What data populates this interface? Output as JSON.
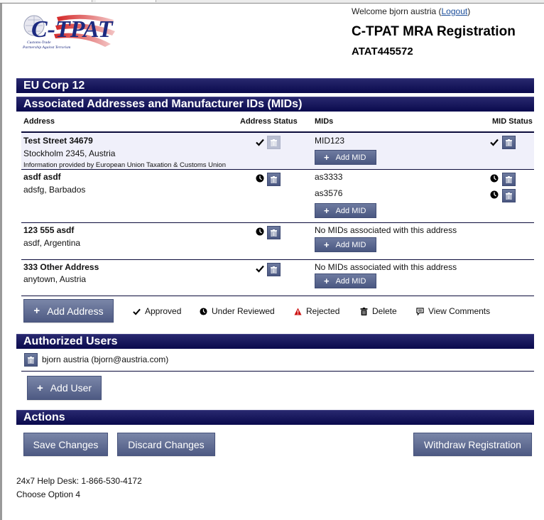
{
  "header": {
    "welcome_prefix": "Welcome bjorn austria (",
    "logout_label": "Logout",
    "welcome_suffix": ")",
    "title": "C-TPAT MRA Registration",
    "registration_id": "ATAT445572",
    "logo": {
      "main": "C-TPAT",
      "tagline_1": "Customs-Trade",
      "tagline_2": "Partnership Against Terrorism"
    }
  },
  "company": {
    "name": "EU Corp 12"
  },
  "addresses_section": {
    "title": "Associated Addresses and Manufacturer IDs (MIDs)",
    "columns": {
      "address": "Address",
      "address_status": "Address Status",
      "mids": "MIDs",
      "mid_status": "MID Status"
    },
    "add_mid_label": "Add MID",
    "no_mids_text": "No MIDs associated with this address",
    "rows": [
      {
        "title": "Test Street 34679",
        "line": "Stockholm 2345, Austria",
        "note": "Information provided by European Union Taxation & Customs Union",
        "status": "approved",
        "delete_disabled": true,
        "mids": [
          {
            "id": "MID123",
            "status": "approved"
          }
        ]
      },
      {
        "title": "asdf asdf",
        "line": "adsfg, Barbados",
        "status": "under-review",
        "mids": [
          {
            "id": "as3333",
            "status": "under-review"
          },
          {
            "id": "as3576",
            "status": "under-review"
          }
        ]
      },
      {
        "title": "123 555 asdf",
        "line": "asdf, Argentina",
        "status": "under-review",
        "mids": []
      },
      {
        "title": "333 Other Address",
        "line": "anytown, Austria",
        "status": "approved",
        "mids": []
      }
    ],
    "add_address_label": "Add Address",
    "legend": {
      "approved": "Approved",
      "under_review": "Under Reviewed",
      "rejected": "Rejected",
      "delete": "Delete",
      "view_comments": "View Comments"
    },
    "colors": {
      "rejected": "#cc1111",
      "bar": "#0a0a4d",
      "button": "#4e5a83"
    }
  },
  "users_section": {
    "title": "Authorized Users",
    "users": [
      {
        "label": "bjorn austria (bjorn@austria.com)"
      }
    ],
    "add_user_label": "Add User"
  },
  "actions_section": {
    "title": "Actions",
    "save_label": "Save Changes",
    "discard_label": "Discard Changes",
    "withdraw_label": "Withdraw Registration"
  },
  "footer": {
    "help_desk": "24x7 Help Desk: 1-866-530-4172",
    "option": "Choose Option 4"
  }
}
